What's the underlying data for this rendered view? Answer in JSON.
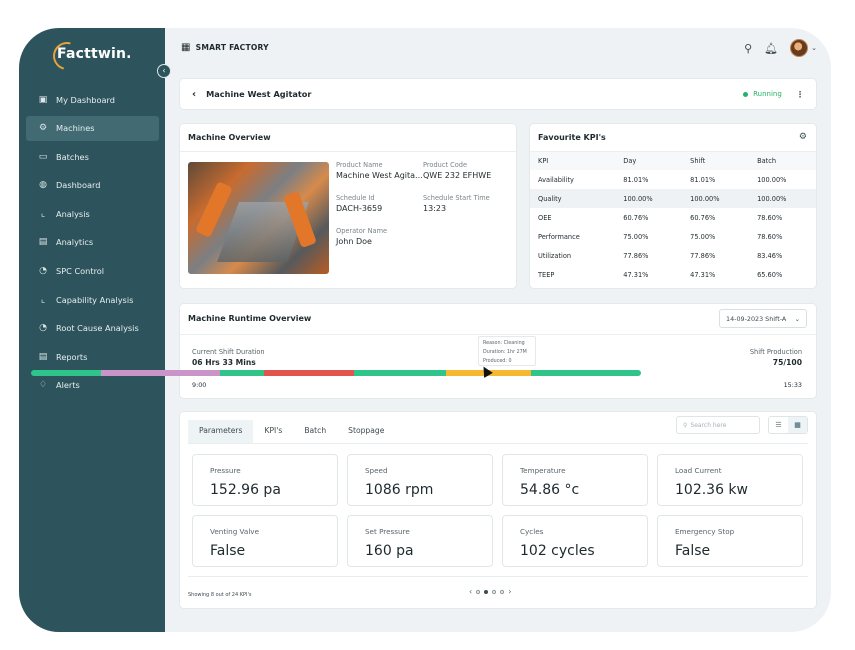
{
  "app": {
    "logo": "Facttwin.",
    "brand": "SMART FACTORY"
  },
  "sidebar": {
    "items": [
      {
        "label": "My Dashboard",
        "icon": "dashboard-icon"
      },
      {
        "label": "Machines",
        "icon": "gears-icon",
        "active": true
      },
      {
        "label": "Batches",
        "icon": "batches-icon"
      },
      {
        "label": "Dashboard",
        "icon": "globe-icon"
      },
      {
        "label": "Analysis",
        "icon": "trend-icon"
      },
      {
        "label": "Analytics",
        "icon": "calculator-icon"
      },
      {
        "label": "SPC Control",
        "icon": "pie-icon"
      },
      {
        "label": "Capability Analysis",
        "icon": "trend-icon"
      },
      {
        "label": "Root Cause Analysis",
        "icon": "pie-icon"
      },
      {
        "label": "Reports",
        "icon": "report-icon"
      },
      {
        "label": "Alerts",
        "icon": "bell-icon"
      }
    ]
  },
  "header": {
    "title": "Machine West Agitator",
    "status": "Running",
    "status_color": "#25b36b"
  },
  "overview": {
    "title": "Machine Overview",
    "product_name_label": "Product Name",
    "product_name": "Machine West Agita...",
    "product_code_label": "Product Code",
    "product_code": "QWE 232 EFHWE",
    "schedule_id_label": "Schedule Id",
    "schedule_id": "DACH-3659",
    "schedule_start_label": "Schedule Start Time",
    "schedule_start": "13:23",
    "operator_label": "Operator Name",
    "operator": "John Doe"
  },
  "kpi": {
    "title": "Favourite KPI's",
    "columns": [
      "KPI",
      "Day",
      "Shift",
      "Batch"
    ],
    "rows": [
      [
        "Availability",
        "81.01%",
        "81.01%",
        "100.00%"
      ],
      [
        "Quality",
        "100.00%",
        "100.00%",
        "100.00%"
      ],
      [
        "OEE",
        "60.76%",
        "60.76%",
        "78.60%"
      ],
      [
        "Performance",
        "75.00%",
        "75.00%",
        "78.60%"
      ],
      [
        "Utilization",
        "77.86%",
        "77.86%",
        "83.46%"
      ],
      [
        "TEEP",
        "47.31%",
        "47.31%",
        "65.60%"
      ]
    ]
  },
  "runtime": {
    "title": "Machine Runtime Overview",
    "date_select": "14-09-2023 Shift-A",
    "duration_label": "Current Shift Duration",
    "duration": "06 Hrs 33 Mins",
    "production_label": "Shift Production",
    "production": "75/100",
    "start": "9:00",
    "end": "15:33",
    "tooltip": [
      "Reason: Cleaning",
      "Duration: 1hr 27M",
      "Produced: 0"
    ],
    "segments": [
      {
        "fraction": 0.115,
        "color": "#2ec48a"
      },
      {
        "fraction": 0.195,
        "color": "#c994c7"
      },
      {
        "fraction": 0.072,
        "color": "#2ec48a"
      },
      {
        "fraction": 0.148,
        "color": "#e2554d"
      },
      {
        "fraction": 0.15,
        "color": "#2ec48a"
      },
      {
        "fraction": 0.14,
        "color": "#f5b82e"
      },
      {
        "fraction": 0.18,
        "color": "#2ec48a"
      }
    ]
  },
  "params": {
    "tabs": [
      "Parameters",
      "KPI's",
      "Batch",
      "Stoppage"
    ],
    "search_placeholder": "Search here",
    "tiles": [
      {
        "label": "Pressure",
        "value": "152.96 pa"
      },
      {
        "label": "Speed",
        "value": "1086 rpm"
      },
      {
        "label": "Temperature",
        "value": "54.86 °c"
      },
      {
        "label": "Load Current",
        "value": "102.36 kw"
      },
      {
        "label": "Venting Valve",
        "value": "False"
      },
      {
        "label": "Set Pressure",
        "value": "160 pa"
      },
      {
        "label": "Cycles",
        "value": "102 cycles"
      },
      {
        "label": "Emergency Stop",
        "value": "False"
      }
    ],
    "footer": "Showing 8 out of  24 KPI's"
  }
}
